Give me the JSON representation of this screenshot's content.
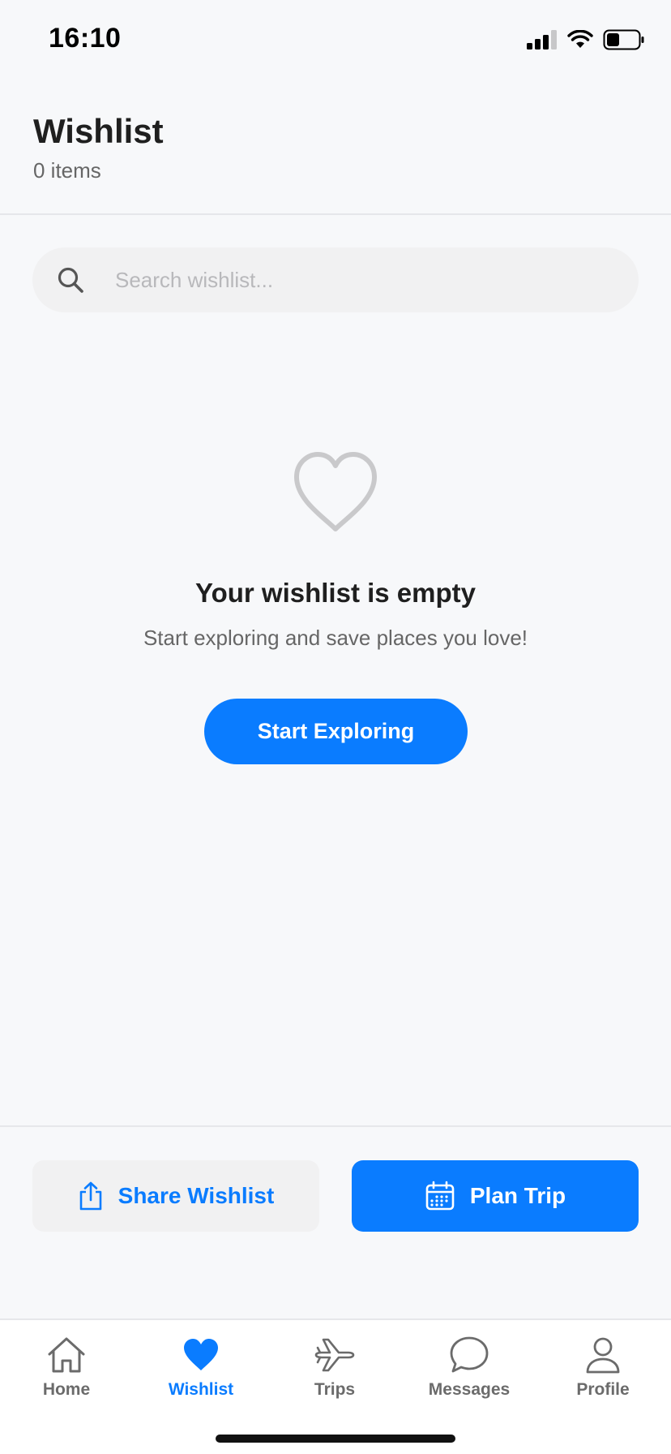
{
  "status": {
    "time": "16:10"
  },
  "header": {
    "title": "Wishlist",
    "count": "0 items"
  },
  "search": {
    "placeholder": "Search wishlist..."
  },
  "empty_state": {
    "title": "Your wishlist is empty",
    "subtitle": "Start exploring and save places you love!",
    "button": "Start Exploring"
  },
  "actions": {
    "share_label": "Share Wishlist",
    "plan_label": "Plan Trip"
  },
  "tabs": [
    {
      "label": "Home",
      "icon": "home-icon",
      "active": false
    },
    {
      "label": "Wishlist",
      "icon": "heart-icon",
      "active": true
    },
    {
      "label": "Trips",
      "icon": "airplane-icon",
      "active": false
    },
    {
      "label": "Messages",
      "icon": "chat-bubble-icon",
      "active": false
    },
    {
      "label": "Profile",
      "icon": "person-icon",
      "active": false
    }
  ],
  "colors": {
    "accent": "#0a7cff",
    "background": "#f7f8fa",
    "muted": "#6b6b6b"
  }
}
